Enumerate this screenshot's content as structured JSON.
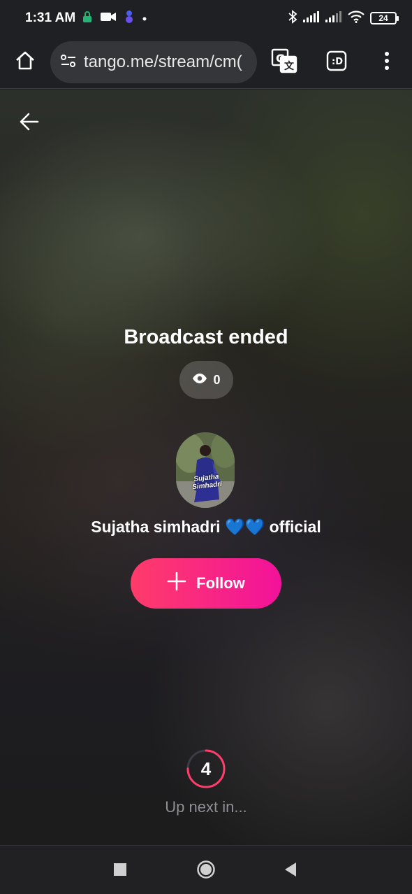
{
  "status_bar": {
    "time": "1:31 AM",
    "battery_level": "24",
    "icons": [
      "lock-icon",
      "video-camera-icon",
      "app-notification-icon",
      "dot-icon",
      "bluetooth-icon",
      "signal-icon",
      "signal-icon",
      "wifi-icon",
      "battery-icon"
    ]
  },
  "browser": {
    "url": "tango.me/stream/cm("
  },
  "stream": {
    "title": "Broadcast ended",
    "viewer_count": "0",
    "avatar_caption": "Sujatha Simhadri",
    "streamer_name": "Sujatha simhadri 💙💙 official",
    "follow_label": "Follow",
    "countdown": "4",
    "countdown_progress": 0.75,
    "up_next": "Up next in..."
  },
  "colors": {
    "follow_start": "#ff3c6a",
    "follow_end": "#f2129a",
    "countdown_ring": "#ff3c6a"
  }
}
